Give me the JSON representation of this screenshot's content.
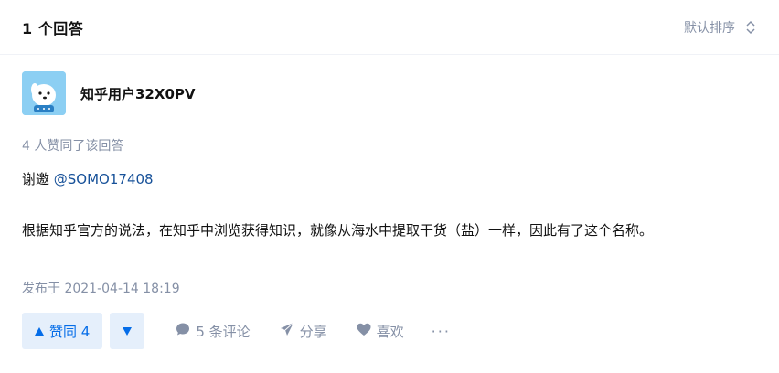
{
  "header": {
    "answer_count": "1 个回答",
    "sort_label": "默认排序"
  },
  "answer": {
    "author_name": "知乎用户32X0PV",
    "votes_note": "4 人赞同了该回答",
    "thanks_prefix": "谢邀 ",
    "mention": "@SOMO17408",
    "paragraph": "根据知乎官方的说法，在知乎中浏览获得知识，就像从海水中提取干货（盐）一样，因此有了这个名称。",
    "published": "发布于 2021-04-14 18:19"
  },
  "actions": {
    "upvote_label": "赞同 4",
    "comments_label": "5 条评论",
    "share_label": "分享",
    "like_label": "喜欢",
    "more_label": "···"
  },
  "colors": {
    "accent": "#056de8",
    "accent_bg": "#e5effb",
    "muted": "#8590a6",
    "link": "#175199"
  }
}
